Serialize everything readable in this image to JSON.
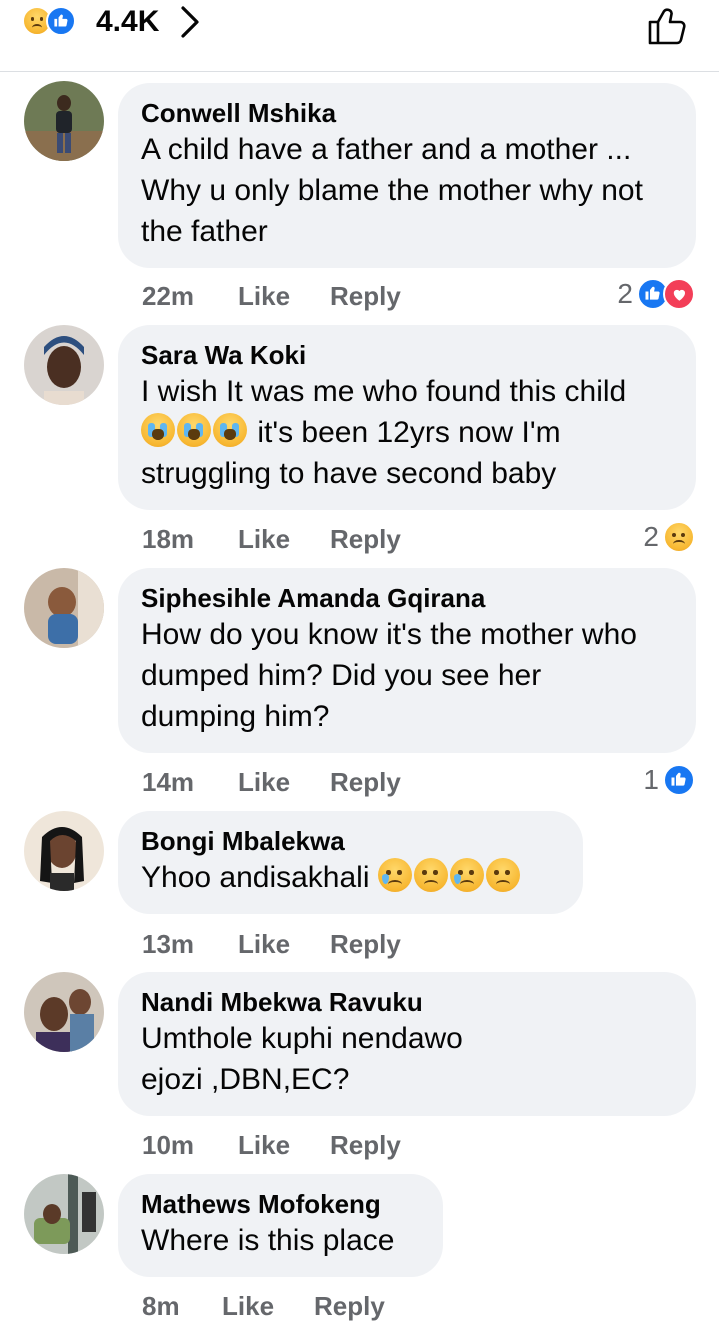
{
  "header": {
    "reaction_count": "4.4K",
    "reaction_icons": [
      "sad-icon",
      "like-icon"
    ]
  },
  "colors": {
    "like_blue": "#1877f2",
    "love_red": "#f33e58",
    "bubble_bg": "#f0f2f5",
    "meta_grey": "#65676b"
  },
  "comments": [
    {
      "author": "Conwell Mshika",
      "lines": [
        "A child have a father and a mother  ...",
        "Why u only blame the mother why not",
        "the father"
      ],
      "time": "22m",
      "like_label": "Like",
      "reply_label": "Reply",
      "reaction_count": "2",
      "reactions": [
        "like-icon",
        "love-icon"
      ]
    },
    {
      "author": "Sara Wa Koki",
      "lines": [
        "I wish It was me who found this child",
        "it's been 12yrs now I'm",
        "struggling to have second baby"
      ],
      "inline_emojis": [
        "crying-face-icon",
        "crying-face-icon",
        "crying-face-icon"
      ],
      "time": "18m",
      "like_label": "Like",
      "reply_label": "Reply",
      "reaction_count": "2",
      "reactions": [
        "sad-icon"
      ]
    },
    {
      "author": "Siphesihle Amanda Gqirana",
      "lines": [
        "How do you know it's the mother who",
        "dumped him? Did you see her",
        "dumping him?"
      ],
      "time": "14m",
      "like_label": "Like",
      "reply_label": "Reply",
      "reaction_count": "1",
      "reactions": [
        "like-icon"
      ]
    },
    {
      "author": "Bongi Mbalekwa",
      "lines": [
        "Yhoo andisakhali"
      ],
      "inline_emojis": [
        "sad-tear-icon",
        "worried-icon",
        "sad-tear-icon",
        "worried-icon"
      ],
      "time": "13m",
      "like_label": "Like",
      "reply_label": "Reply"
    },
    {
      "author": "Nandi Mbekwa Ravuku",
      "lines": [
        "Umthole kuphi nendawo",
        "ejozi ,DBN,EC?"
      ],
      "time": "10m",
      "like_label": "Like",
      "reply_label": "Reply"
    },
    {
      "author": "Mathews Mofokeng",
      "lines": [
        "Where is this place"
      ],
      "time": "8m",
      "like_label": "Like",
      "reply_label": "Reply"
    }
  ]
}
